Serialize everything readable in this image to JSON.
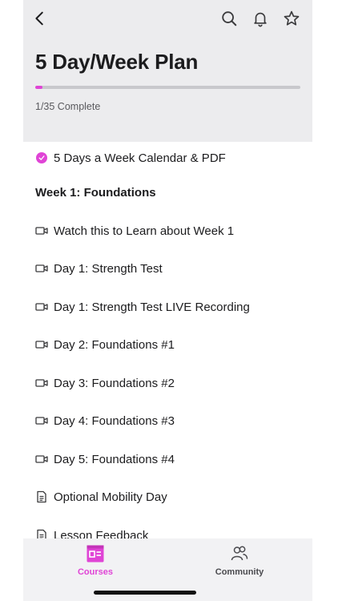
{
  "header": {
    "title": "5 Day/Week Plan",
    "progress_fraction": 0.0286,
    "progress_label": "1/35 Complete",
    "accent": "#e044d6",
    "icons": [
      "back-icon",
      "search-icon",
      "bell-icon",
      "star-icon"
    ]
  },
  "list": {
    "completed_item": "5 Days a Week Calendar  & PDF",
    "section_title": "Week 1: Foundations",
    "items": [
      {
        "label": "Watch this to Learn about Week 1",
        "icon": "video-icon"
      },
      {
        "label": "Day 1: Strength Test",
        "icon": "video-icon"
      },
      {
        "label": "Day 1: Strength Test LIVE Recording",
        "icon": "video-icon"
      },
      {
        "label": "Day 2: Foundations #1",
        "icon": "video-icon"
      },
      {
        "label": "Day 3: Foundations #2",
        "icon": "video-icon"
      },
      {
        "label": "Day 4: Foundations #3",
        "icon": "video-icon"
      },
      {
        "label": "Day 5: Foundations #4",
        "icon": "video-icon"
      },
      {
        "label": "Optional Mobility Day",
        "icon": "document-icon"
      },
      {
        "label": "Lesson Feedback",
        "icon": "document-icon"
      }
    ]
  },
  "tabbar": {
    "tabs": [
      {
        "label": "Courses",
        "icon": "courses-icon",
        "active": true,
        "color": "#e044d6"
      },
      {
        "label": "Community",
        "icon": "community-icon",
        "active": false,
        "color": "#4a4a4e"
      }
    ]
  }
}
